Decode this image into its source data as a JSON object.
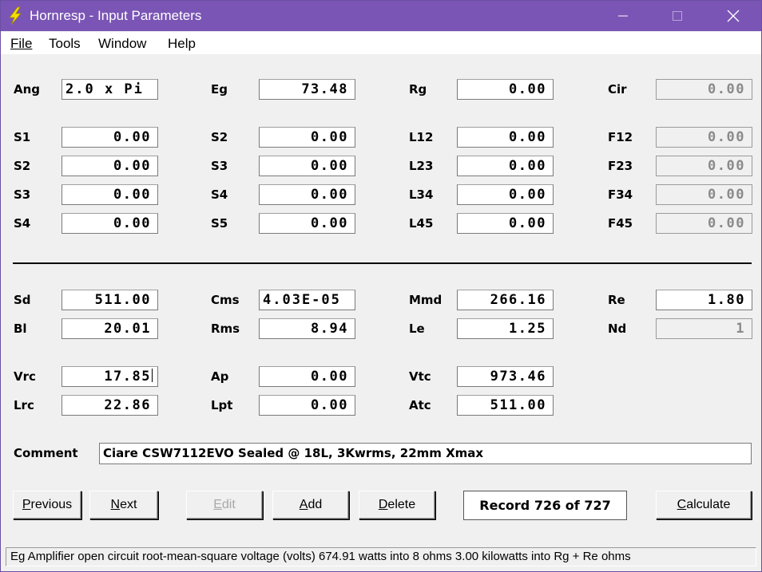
{
  "window": {
    "title": "Hornresp - Input Parameters",
    "icon": "lightning-bolt-icon",
    "titlebar_color": "#7a55b5"
  },
  "menu": {
    "file": "File",
    "tools": "Tools",
    "window": "Window",
    "help": "Help"
  },
  "horn": {
    "ang": {
      "label": "Ang",
      "value": "2.0 x Pi"
    },
    "eg": {
      "label": "Eg",
      "value": "73.48"
    },
    "rg": {
      "label": "Rg",
      "value": "0.00"
    },
    "cir": {
      "label": "Cir",
      "value": "0.00"
    },
    "s1": {
      "label": "S1",
      "value": "0.00"
    },
    "s2": {
      "label": "S2",
      "value": "0.00"
    },
    "s3": {
      "label": "S3",
      "value": "0.00"
    },
    "s4": {
      "label": "S4",
      "value": "0.00"
    },
    "s2b": {
      "label": "S2",
      "value": "0.00"
    },
    "s3b": {
      "label": "S3",
      "value": "0.00"
    },
    "s4b": {
      "label": "S4",
      "value": "0.00"
    },
    "s5": {
      "label": "S5",
      "value": "0.00"
    },
    "l12": {
      "label": "L12",
      "value": "0.00"
    },
    "l23": {
      "label": "L23",
      "value": "0.00"
    },
    "l34": {
      "label": "L34",
      "value": "0.00"
    },
    "l45": {
      "label": "L45",
      "value": "0.00"
    },
    "f12": {
      "label": "F12",
      "value": "0.00"
    },
    "f23": {
      "label": "F23",
      "value": "0.00"
    },
    "f34": {
      "label": "F34",
      "value": "0.00"
    },
    "f45": {
      "label": "F45",
      "value": "0.00"
    }
  },
  "driver": {
    "sd": {
      "label": "Sd",
      "value": "511.00"
    },
    "bl": {
      "label": "Bl",
      "value": "20.01"
    },
    "cms": {
      "label": "Cms",
      "value": "4.03E-05"
    },
    "rms": {
      "label": "Rms",
      "value": "8.94"
    },
    "mmd": {
      "label": "Mmd",
      "value": "266.16"
    },
    "le": {
      "label": "Le",
      "value": "1.25"
    },
    "re": {
      "label": "Re",
      "value": "1.80"
    },
    "nd": {
      "label": "Nd",
      "value": "1"
    }
  },
  "chamber": {
    "vrc": {
      "label": "Vrc",
      "value": "17.85"
    },
    "lrc": {
      "label": "Lrc",
      "value": "22.86"
    },
    "ap": {
      "label": "Ap",
      "value": "0.00"
    },
    "lpt": {
      "label": "Lpt",
      "value": "0.00"
    },
    "vtc": {
      "label": "Vtc",
      "value": "973.46"
    },
    "atc": {
      "label": "Atc",
      "value": "511.00"
    }
  },
  "comment": {
    "label": "Comment",
    "value": "Ciare CSW7112EVO Sealed @ 18L, 3Kwrms, 22mm Xmax"
  },
  "buttons": {
    "previous": {
      "u": "P",
      "rest": "revious"
    },
    "next": {
      "u": "N",
      "rest": "ext"
    },
    "edit": {
      "u": "E",
      "rest": "dit"
    },
    "add": {
      "u": "A",
      "rest": "dd"
    },
    "delete": {
      "u": "D",
      "rest": "elete"
    },
    "calculate": {
      "u": "C",
      "rest": "alculate"
    }
  },
  "record": "Record 726 of 727",
  "status": "Eg  Amplifier open circuit root-mean-square voltage  (volts)   674.91 watts into 8 ohms    3.00 kilowatts into Rg + Re ohms"
}
